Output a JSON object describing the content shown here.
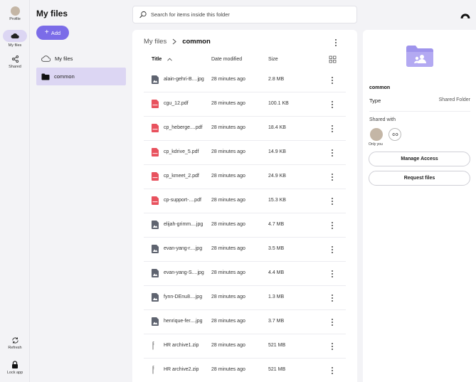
{
  "rail": {
    "profile": "Profile",
    "my_files": "My files",
    "shared": "Shared",
    "refresh": "Refresh",
    "lock": "Lock app"
  },
  "nav": {
    "title": "My files",
    "add_label": "Add",
    "items": [
      {
        "label": "My files"
      },
      {
        "label": "common"
      }
    ]
  },
  "search": {
    "placeholder": "Search for items inside this folder"
  },
  "breadcrumb": {
    "root": "My files",
    "current": "common"
  },
  "table": {
    "headers": {
      "title": "Title",
      "date": "Date modified",
      "size": "Size"
    },
    "rows": [
      {
        "name": "alain-gehri-B....jpg",
        "date": "28 minutes ago",
        "size": "2.8 MB",
        "kind": "image"
      },
      {
        "name": "cgu_12.pdf",
        "date": "28 minutes ago",
        "size": "100.1 KB",
        "kind": "pdf"
      },
      {
        "name": "cp_heberge....pdf",
        "date": "28 minutes ago",
        "size": "18.4 KB",
        "kind": "pdf"
      },
      {
        "name": "cp_kdrive_5.pdf",
        "date": "28 minutes ago",
        "size": "14.9 KB",
        "kind": "pdf"
      },
      {
        "name": "cp_kmeet_2.pdf",
        "date": "28 minutes ago",
        "size": "24.9 KB",
        "kind": "pdf"
      },
      {
        "name": "cp-support-....pdf",
        "date": "28 minutes ago",
        "size": "15.3 KB",
        "kind": "pdf"
      },
      {
        "name": "elijah-grimm....jpg",
        "date": "28 minutes ago",
        "size": "4.7 MB",
        "kind": "image"
      },
      {
        "name": "evan-yang-r....jpg",
        "date": "28 minutes ago",
        "size": "3.5 MB",
        "kind": "image"
      },
      {
        "name": "evan-yang-S....jpg",
        "date": "28 minutes ago",
        "size": "4.4 MB",
        "kind": "image"
      },
      {
        "name": "fynn-DEnu8....jpg",
        "date": "28 minutes ago",
        "size": "1.3 MB",
        "kind": "image"
      },
      {
        "name": "henrique-fer....jpg",
        "date": "28 minutes ago",
        "size": "3.7 MB",
        "kind": "image"
      },
      {
        "name": "HR archive1.zip",
        "date": "28 minutes ago",
        "size": "521 MB",
        "kind": "zip"
      },
      {
        "name": "HR archive2.zip",
        "date": "28 minutes ago",
        "size": "521 MB",
        "kind": "zip"
      }
    ]
  },
  "details": {
    "name": "common",
    "type_label": "Type",
    "type_value": "Shared Folder",
    "shared_with": "Shared with",
    "only_you": "Only you",
    "manage_access": "Manage Access",
    "request_files": "Request files"
  },
  "colors": {
    "accent": "#7b6ce8",
    "active_bg": "#dcd6f3",
    "pdf": "#e8525e",
    "image": "#5f6470",
    "folder": "#9f94ec"
  }
}
